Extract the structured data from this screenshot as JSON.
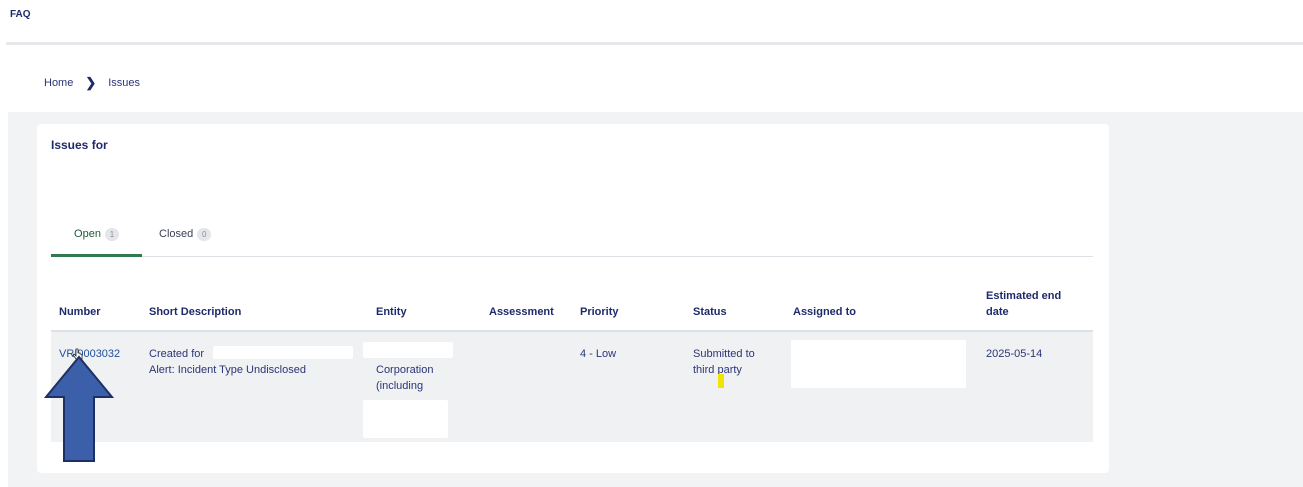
{
  "topbar": {
    "faq_label": "FAQ"
  },
  "breadcrumb": {
    "home": "Home",
    "separator": "›",
    "current": "Issues"
  },
  "card": {
    "title": "Issues for"
  },
  "tabs": [
    {
      "label": "Open",
      "count": "1",
      "active": true
    },
    {
      "label": "Closed",
      "count": "0",
      "active": false
    }
  ],
  "table": {
    "headers": [
      "Number",
      "Short Description",
      "Entity",
      "Assessment",
      "Priority",
      "Status",
      "Assigned to",
      "Estimated end date"
    ],
    "rows": [
      {
        "number": "VRI0003032",
        "description_line1": "Created for",
        "description_line2": "Alert: Incident Type Undisclosed",
        "entity_line1": "Corporation",
        "entity_line2": "(including",
        "assessment": "",
        "priority": "4 - Low",
        "status": "Submitted to third party",
        "assigned_to": "",
        "estimated_end_date": "2025-05-14"
      }
    ]
  },
  "colors": {
    "text_primary": "#1f2a6b",
    "link": "#1f4f9a",
    "active_tab": "#2f7b4d",
    "annotation_arrow": "#3b5fa8",
    "highlight": "#f2e300"
  }
}
